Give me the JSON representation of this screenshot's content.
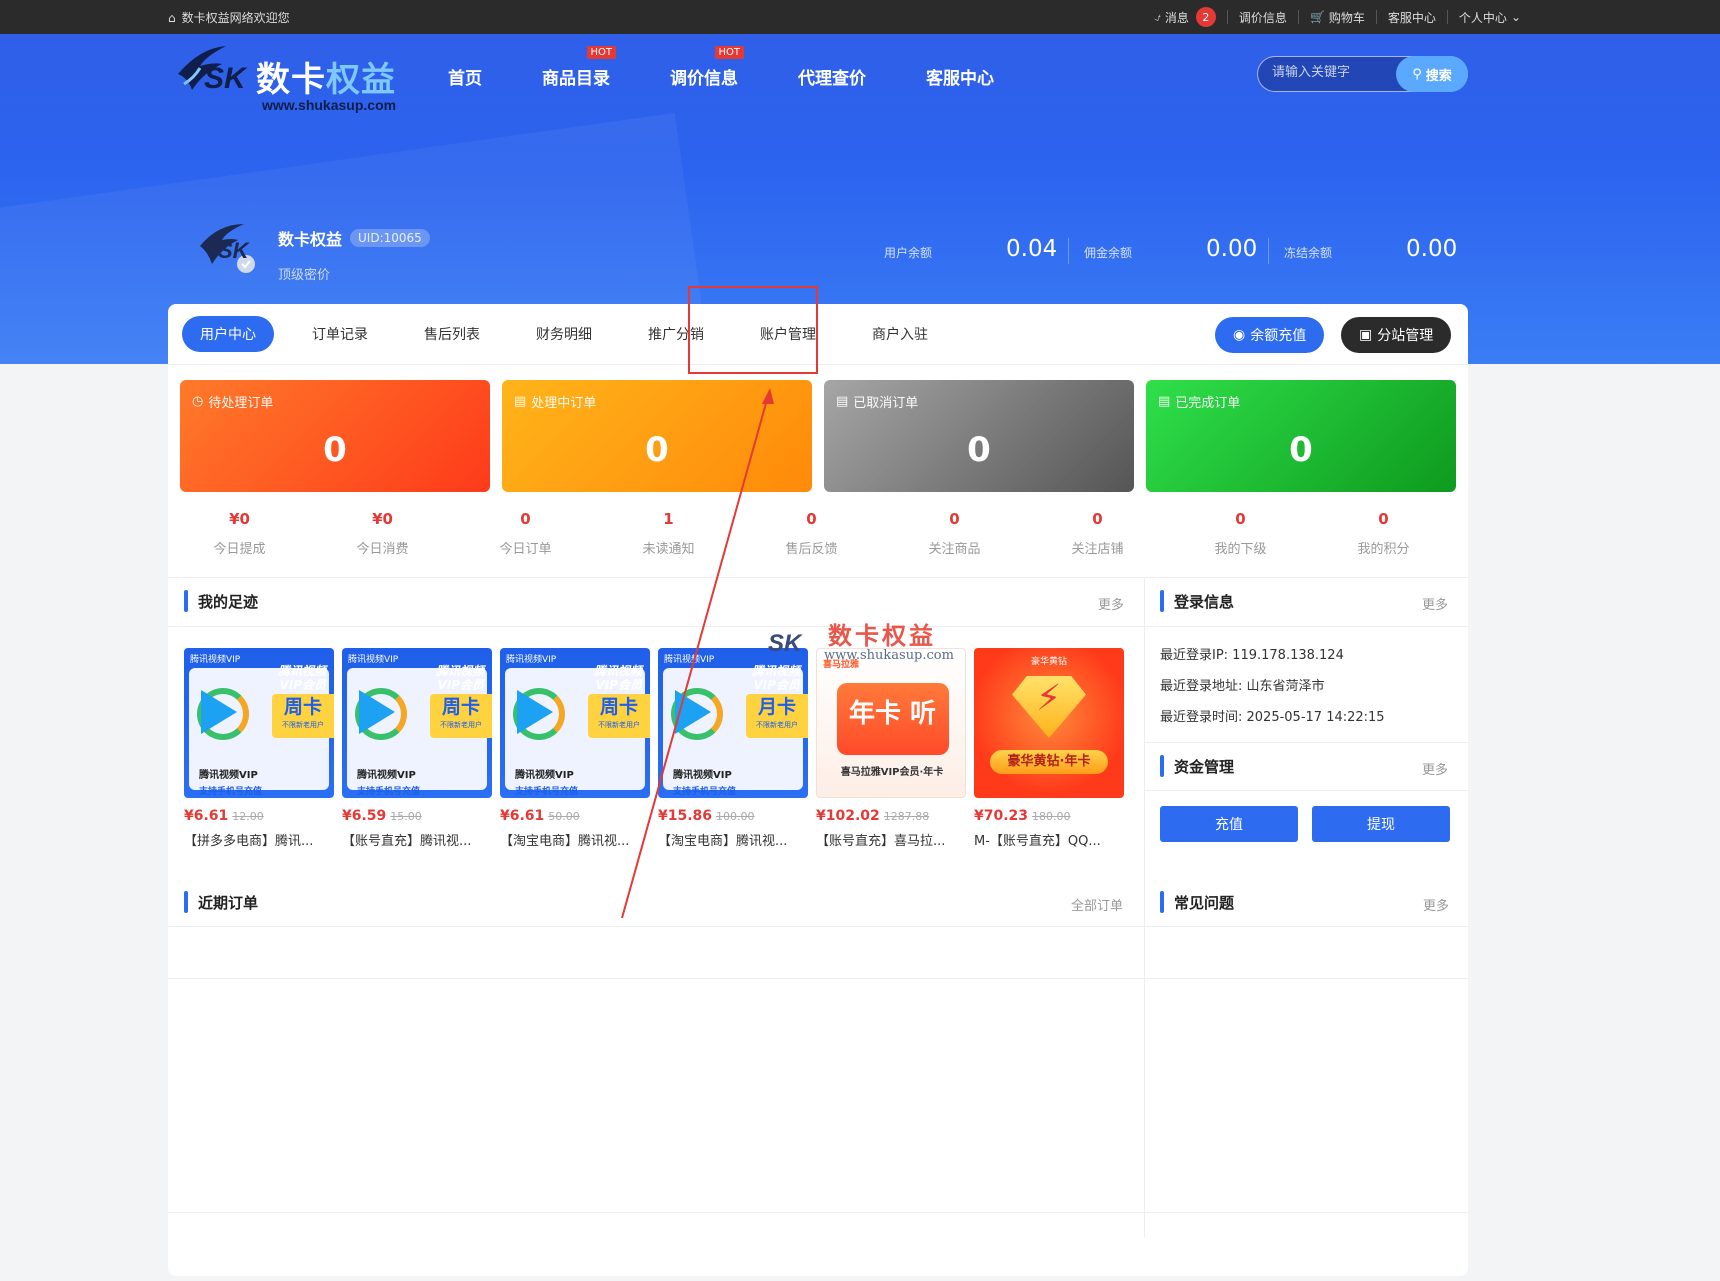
{
  "topbar": {
    "welcome": "数卡权益网络欢迎您",
    "items": [
      {
        "label": "消息",
        "badge": "2"
      },
      {
        "label": "调价信息"
      },
      {
        "label": "购物车"
      },
      {
        "label": "客服中心"
      },
      {
        "label": "个人中心"
      }
    ]
  },
  "logo": {
    "sk": "SK",
    "name_a": "数卡",
    "name_b": "权益",
    "url": "www.shukasup.com"
  },
  "nav": {
    "items": [
      {
        "label": "首页",
        "hot": ""
      },
      {
        "label": "商品目录",
        "hot": "HOT"
      },
      {
        "label": "调价信息",
        "hot": "HOT"
      },
      {
        "label": "代理查价",
        "hot": ""
      },
      {
        "label": "客服中心",
        "hot": ""
      }
    ]
  },
  "search": {
    "placeholder": "请输入关键字",
    "button": "搜索"
  },
  "profile": {
    "avatar_text": "SK",
    "name": "数卡权益",
    "uid": "UID:10065",
    "level": "顶级密价"
  },
  "balances": [
    {
      "label": "用户余额",
      "value": "0.04"
    },
    {
      "label": "佣金余额",
      "value": "0.00"
    },
    {
      "label": "冻结余额",
      "value": "0.00"
    }
  ],
  "tabs": [
    "用户中心",
    "订单记录",
    "售后列表",
    "财务明细",
    "推广分销",
    "账户管理",
    "商户入驻"
  ],
  "tab_buttons": {
    "recharge": "余额充值",
    "site": "分站管理"
  },
  "stats": [
    {
      "label": "待处理订单",
      "value": "0"
    },
    {
      "label": "处理中订单",
      "value": "0"
    },
    {
      "label": "已取消订单",
      "value": "0"
    },
    {
      "label": "已完成订单",
      "value": "0"
    }
  ],
  "mini_stats": [
    {
      "value": "¥0",
      "label": "今日提成"
    },
    {
      "value": "¥0",
      "label": "今日消费"
    },
    {
      "value": "0",
      "label": "今日订单"
    },
    {
      "value": "1",
      "label": "未读通知"
    },
    {
      "value": "0",
      "label": "售后反馈"
    },
    {
      "value": "0",
      "label": "关注商品"
    },
    {
      "value": "0",
      "label": "关注店铺"
    },
    {
      "value": "0",
      "label": "我的下级"
    },
    {
      "value": "0",
      "label": "我的积分"
    }
  ],
  "footprint": {
    "title": "我的足迹",
    "more": "更多",
    "products": [
      {
        "tag": "腾讯视频VIP",
        "vip": "腾讯视频 VIP会员",
        "card": "周卡",
        "card_sub": "不限新老用户",
        "l1": "腾讯视频VIP",
        "l2": "支持手机号充值",
        "price": "¥6.61",
        "old": "12.00",
        "title": "【拼多多电商】腾讯..."
      },
      {
        "tag": "腾讯视频VIP",
        "vip": "腾讯视频 VIP会员",
        "card": "周卡",
        "card_sub": "不限新老用户",
        "l1": "腾讯视频VIP",
        "l2": "支持手机号充值",
        "price": "¥6.59",
        "old": "15.00",
        "title": "【账号直充】腾讯视..."
      },
      {
        "tag": "腾讯视频VIP",
        "vip": "腾讯视频 VIP会员",
        "card": "周卡",
        "card_sub": "不限新老用户",
        "l1": "腾讯视频VIP",
        "l2": "支持手机号充值",
        "price": "¥6.61",
        "old": "50.00",
        "title": "【淘宝电商】腾讯视..."
      },
      {
        "tag": "腾讯视频VIP",
        "vip": "腾讯视频 VIP会员",
        "card": "月卡",
        "card_sub": "不限新老用户",
        "l1": "腾讯视频VIP",
        "l2": "支持手机号充值",
        "price": "¥15.86",
        "old": "100.00",
        "title": "【淘宝电商】腾讯视..."
      },
      {
        "tag": "喜马拉雅",
        "big": "年卡 听",
        "sub": "喜马拉雅VIP会员·年卡",
        "price": "¥102.02",
        "old": "1287.88",
        "title": "【账号直充】喜马拉..."
      },
      {
        "tag": "豪华黄钻",
        "big": "豪华黄钻·年卡",
        "price": "¥70.23",
        "old": "180.00",
        "title": "M-【账号直充】QQ..."
      }
    ]
  },
  "login_info": {
    "title": "登录信息",
    "more": "更多",
    "ip": "最近登录IP: 119.178.138.124",
    "addr": "最近登录地址: 山东省菏泽市",
    "time": "最近登录时间: 2025-05-17 14:22:15"
  },
  "funds": {
    "title": "资金管理",
    "more": "更多",
    "recharge": "充值",
    "withdraw": "提现"
  },
  "recent_orders": {
    "title": "近期订单",
    "more": "全部订单"
  },
  "faq": {
    "title": "常见问题",
    "more": "更多"
  },
  "watermark": {
    "sk": "SK",
    "name": "数卡权益",
    "url": "www.shukasup.com"
  },
  "colors": {
    "accent": "#2d6cf0",
    "price": "#e53935",
    "highlight": "#e53935"
  }
}
